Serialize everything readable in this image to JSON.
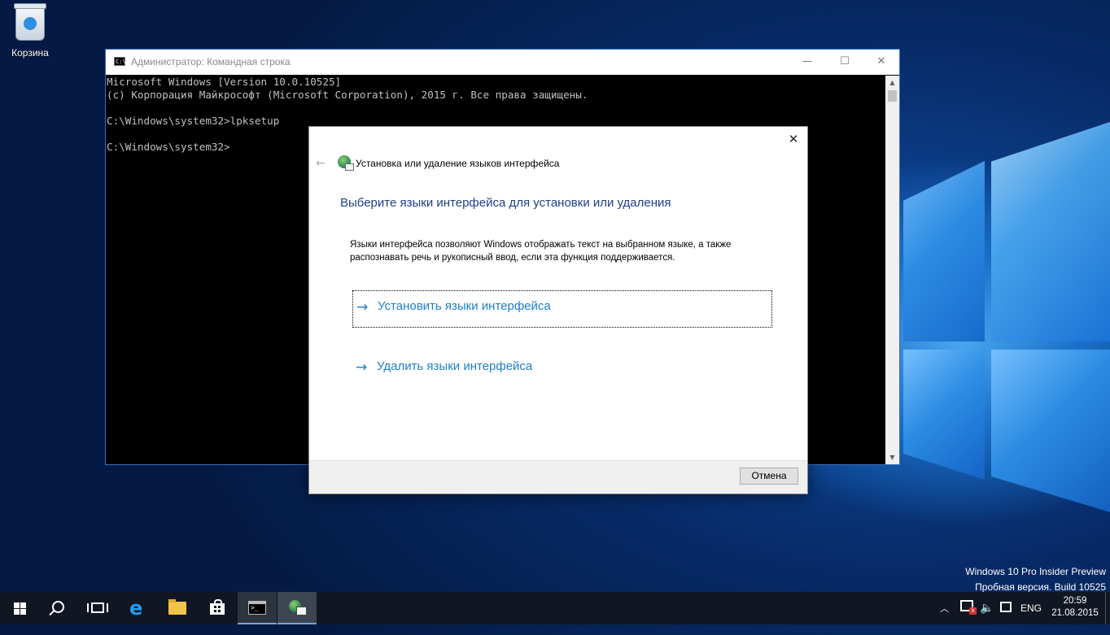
{
  "desktop": {
    "recycle_bin_label": "Корзина",
    "watermark": {
      "line1": "Windows 10 Pro Insider Preview",
      "line2": "Пробная версия. Build 10525"
    }
  },
  "cmd_window": {
    "title": "Администратор: Командная строка",
    "buttons": {
      "minimize": "—",
      "maximize": "☐",
      "close": "✕"
    },
    "lines": [
      "Microsoft Windows [Version 10.0.10525]",
      "(c) Корпорация Майкрософт (Microsoft Corporation), 2015 г. Все права защищены.",
      "",
      "C:\\Windows\\system32>lpksetup",
      "",
      "C:\\Windows\\system32>"
    ]
  },
  "dialog": {
    "title": "Установка или удаление языков интерфейса",
    "heading": "Выберите языки интерфейса для установки или удаления",
    "description": "Языки интерфейса позволяют Windows отображать текст на выбранном языке, а также распознавать речь и рукописный ввод, если эта функция поддерживается.",
    "options": [
      {
        "label": "Установить языки интерфейса",
        "focused": true
      },
      {
        "label": "Удалить языки интерфейса",
        "focused": false
      }
    ],
    "cancel_label": "Отмена",
    "link_color": "#1e7fc8",
    "heading_color": "#1e3f8a"
  },
  "taskbar": {
    "icons": [
      "start-icon",
      "search-icon",
      "task-view-icon",
      "edge-icon",
      "file-explorer-icon",
      "store-icon",
      "cmd-icon",
      "language-setup-icon"
    ],
    "tray": {
      "language": "ENG",
      "time": "20:59",
      "date": "21.08.2015"
    }
  }
}
